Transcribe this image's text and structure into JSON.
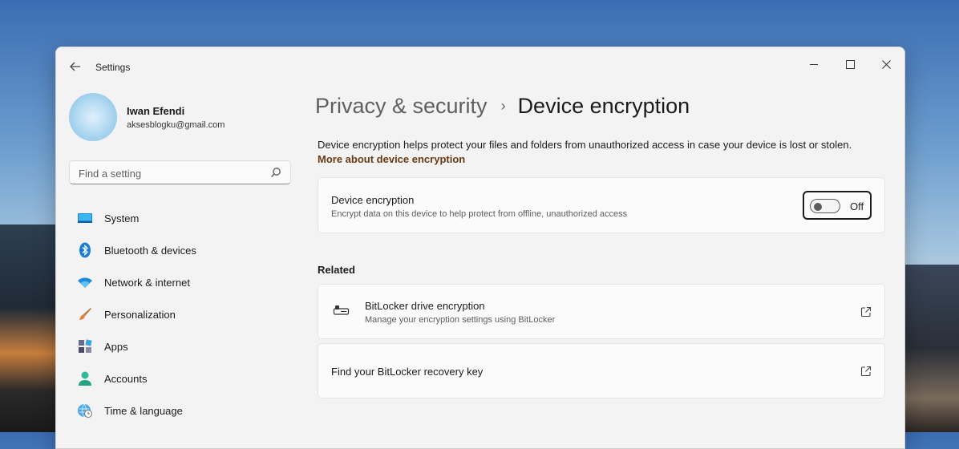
{
  "window": {
    "title": "Settings"
  },
  "profile": {
    "name": "Iwan Efendi",
    "email": "aksesblogku@gmail.com"
  },
  "search": {
    "placeholder": "Find a setting"
  },
  "sidebar": {
    "items": [
      {
        "label": "System",
        "icon": "system-icon"
      },
      {
        "label": "Bluetooth & devices",
        "icon": "bluetooth-icon"
      },
      {
        "label": "Network & internet",
        "icon": "wifi-icon"
      },
      {
        "label": "Personalization",
        "icon": "brush-icon"
      },
      {
        "label": "Apps",
        "icon": "apps-icon"
      },
      {
        "label": "Accounts",
        "icon": "accounts-icon"
      },
      {
        "label": "Time & language",
        "icon": "globe-clock-icon"
      }
    ]
  },
  "breadcrumb": {
    "parent": "Privacy & security",
    "separator": "›",
    "current": "Device encryption"
  },
  "description": {
    "text": "Device encryption helps protect your files and folders from unauthorized access in case your device is lost or stolen.",
    "link": "More about device encryption"
  },
  "encryption_card": {
    "title": "Device encryption",
    "subtitle": "Encrypt data on this device to help protect from offline, unauthorized access",
    "toggle_state": "Off"
  },
  "related": {
    "heading": "Related",
    "items": [
      {
        "title": "BitLocker drive encryption",
        "subtitle": "Manage your encryption settings using BitLocker",
        "icon": "bitlocker-key-icon"
      },
      {
        "title": "Find your BitLocker recovery key"
      }
    ]
  },
  "colors": {
    "accent": "#0067c0",
    "link": "#6b3a12",
    "window_bg": "#f3f3f3",
    "card_bg": "#fbfbfb"
  }
}
